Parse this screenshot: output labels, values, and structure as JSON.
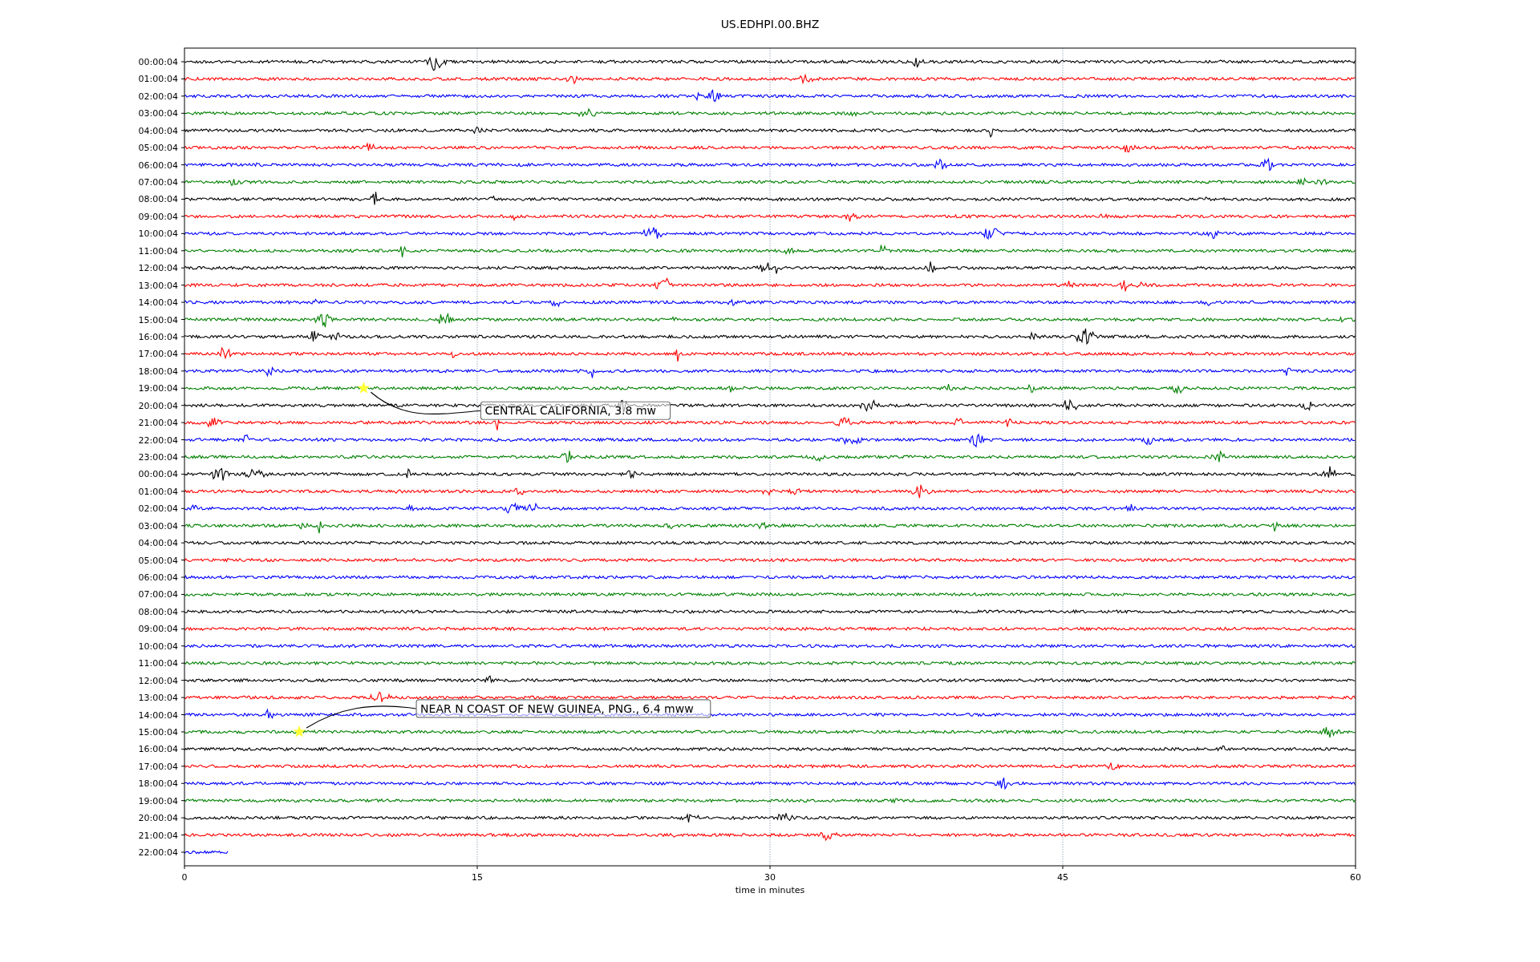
{
  "title": "US.EDHPI.00.BHZ",
  "x_ticks": [
    "0",
    "15",
    "30",
    "45",
    "60"
  ],
  "x_label": "time in minutes",
  "rows": [
    {
      "label": "00:00:04",
      "color": "#000000",
      "level": 1
    },
    {
      "label": "01:00:04",
      "color": "#ff0000",
      "level": 1
    },
    {
      "label": "02:00:04",
      "color": "#0000ff",
      "level": 1
    },
    {
      "label": "03:00:04",
      "color": "#008000",
      "level": 1
    },
    {
      "label": "04:00:04",
      "color": "#000000",
      "level": 1
    },
    {
      "label": "05:00:04",
      "color": "#ff0000",
      "level": 1
    },
    {
      "label": "06:00:04",
      "color": "#0000ff",
      "level": 1
    },
    {
      "label": "07:00:04",
      "color": "#008000",
      "level": 1
    },
    {
      "label": "08:00:04",
      "color": "#000000",
      "level": 1
    },
    {
      "label": "09:00:04",
      "color": "#ff0000",
      "level": 1
    },
    {
      "label": "10:00:04",
      "color": "#0000ff",
      "level": 1
    },
    {
      "label": "11:00:04",
      "color": "#008000",
      "level": 1
    },
    {
      "label": "12:00:04",
      "color": "#000000",
      "level": 1
    },
    {
      "label": "13:00:04",
      "color": "#ff0000",
      "level": 1
    },
    {
      "label": "14:00:04",
      "color": "#0000ff",
      "level": 1
    },
    {
      "label": "15:00:04",
      "color": "#008000",
      "level": 1
    },
    {
      "label": "16:00:04",
      "color": "#000000",
      "level": 1
    },
    {
      "label": "17:00:04",
      "color": "#ff0000",
      "level": 1
    },
    {
      "label": "18:00:04",
      "color": "#0000ff",
      "level": 1
    },
    {
      "label": "19:00:04",
      "color": "#008000",
      "level": 1,
      "event": {
        "label": "CENTRAL CALIFORNIA, 3.8 mw",
        "level": 0.153
      }
    },
    {
      "label": "20:00:04",
      "color": "#000000",
      "level": 1
    },
    {
      "label": "21:00:04",
      "color": "#ff0000",
      "level": 1
    },
    {
      "label": "22:00:04",
      "color": "#0000ff",
      "level": 1
    },
    {
      "label": "23:00:04",
      "color": "#008000",
      "level": 1
    },
    {
      "label": "00:00:04",
      "color": "#000000",
      "level": 1
    },
    {
      "label": "01:00:04",
      "color": "#ff0000",
      "level": 1
    },
    {
      "label": "02:00:04",
      "color": "#0000ff",
      "level": 1
    },
    {
      "label": "03:00:04",
      "color": "#008000",
      "level": 1
    },
    {
      "label": "04:00:04",
      "color": "#000000",
      "level": 1
    },
    {
      "label": "05:00:04",
      "color": "#ff0000",
      "level": 1
    },
    {
      "label": "06:00:04",
      "color": "#0000ff",
      "level": 1
    },
    {
      "label": "07:00:04",
      "color": "#008000",
      "level": 1
    },
    {
      "label": "08:00:04",
      "color": "#000000",
      "level": 1
    },
    {
      "label": "09:00:04",
      "color": "#ff0000",
      "level": 1
    },
    {
      "label": "10:00:04",
      "color": "#0000ff",
      "level": 1
    },
    {
      "label": "11:00:04",
      "color": "#008000",
      "level": 1
    },
    {
      "label": "12:00:04",
      "color": "#000000",
      "level": 1
    },
    {
      "label": "13:00:04",
      "color": "#ff0000",
      "level": 1
    },
    {
      "label": "14:00:04",
      "color": "#0000ff",
      "level": 1
    },
    {
      "label": "15:00:04",
      "color": "#008000",
      "level": 1,
      "event": {
        "label": "NEAR N COAST OF NEW GUINEA, PNG., 6.4 mww",
        "level": 0.098
      }
    },
    {
      "label": "16:00:04",
      "color": "#000000",
      "level": 1
    },
    {
      "label": "17:00:04",
      "color": "#ff0000",
      "level": 1
    },
    {
      "label": "18:00:04",
      "color": "#0000ff",
      "level": 1
    },
    {
      "label": "19:00:04",
      "color": "#008000",
      "level": 1
    },
    {
      "label": "20:00:04",
      "color": "#000000",
      "level": 1
    },
    {
      "label": "21:00:04",
      "color": "#ff0000",
      "level": 1
    },
    {
      "label": "22:00:04",
      "color": "#0000ff",
      "level": 0.037
    }
  ]
}
